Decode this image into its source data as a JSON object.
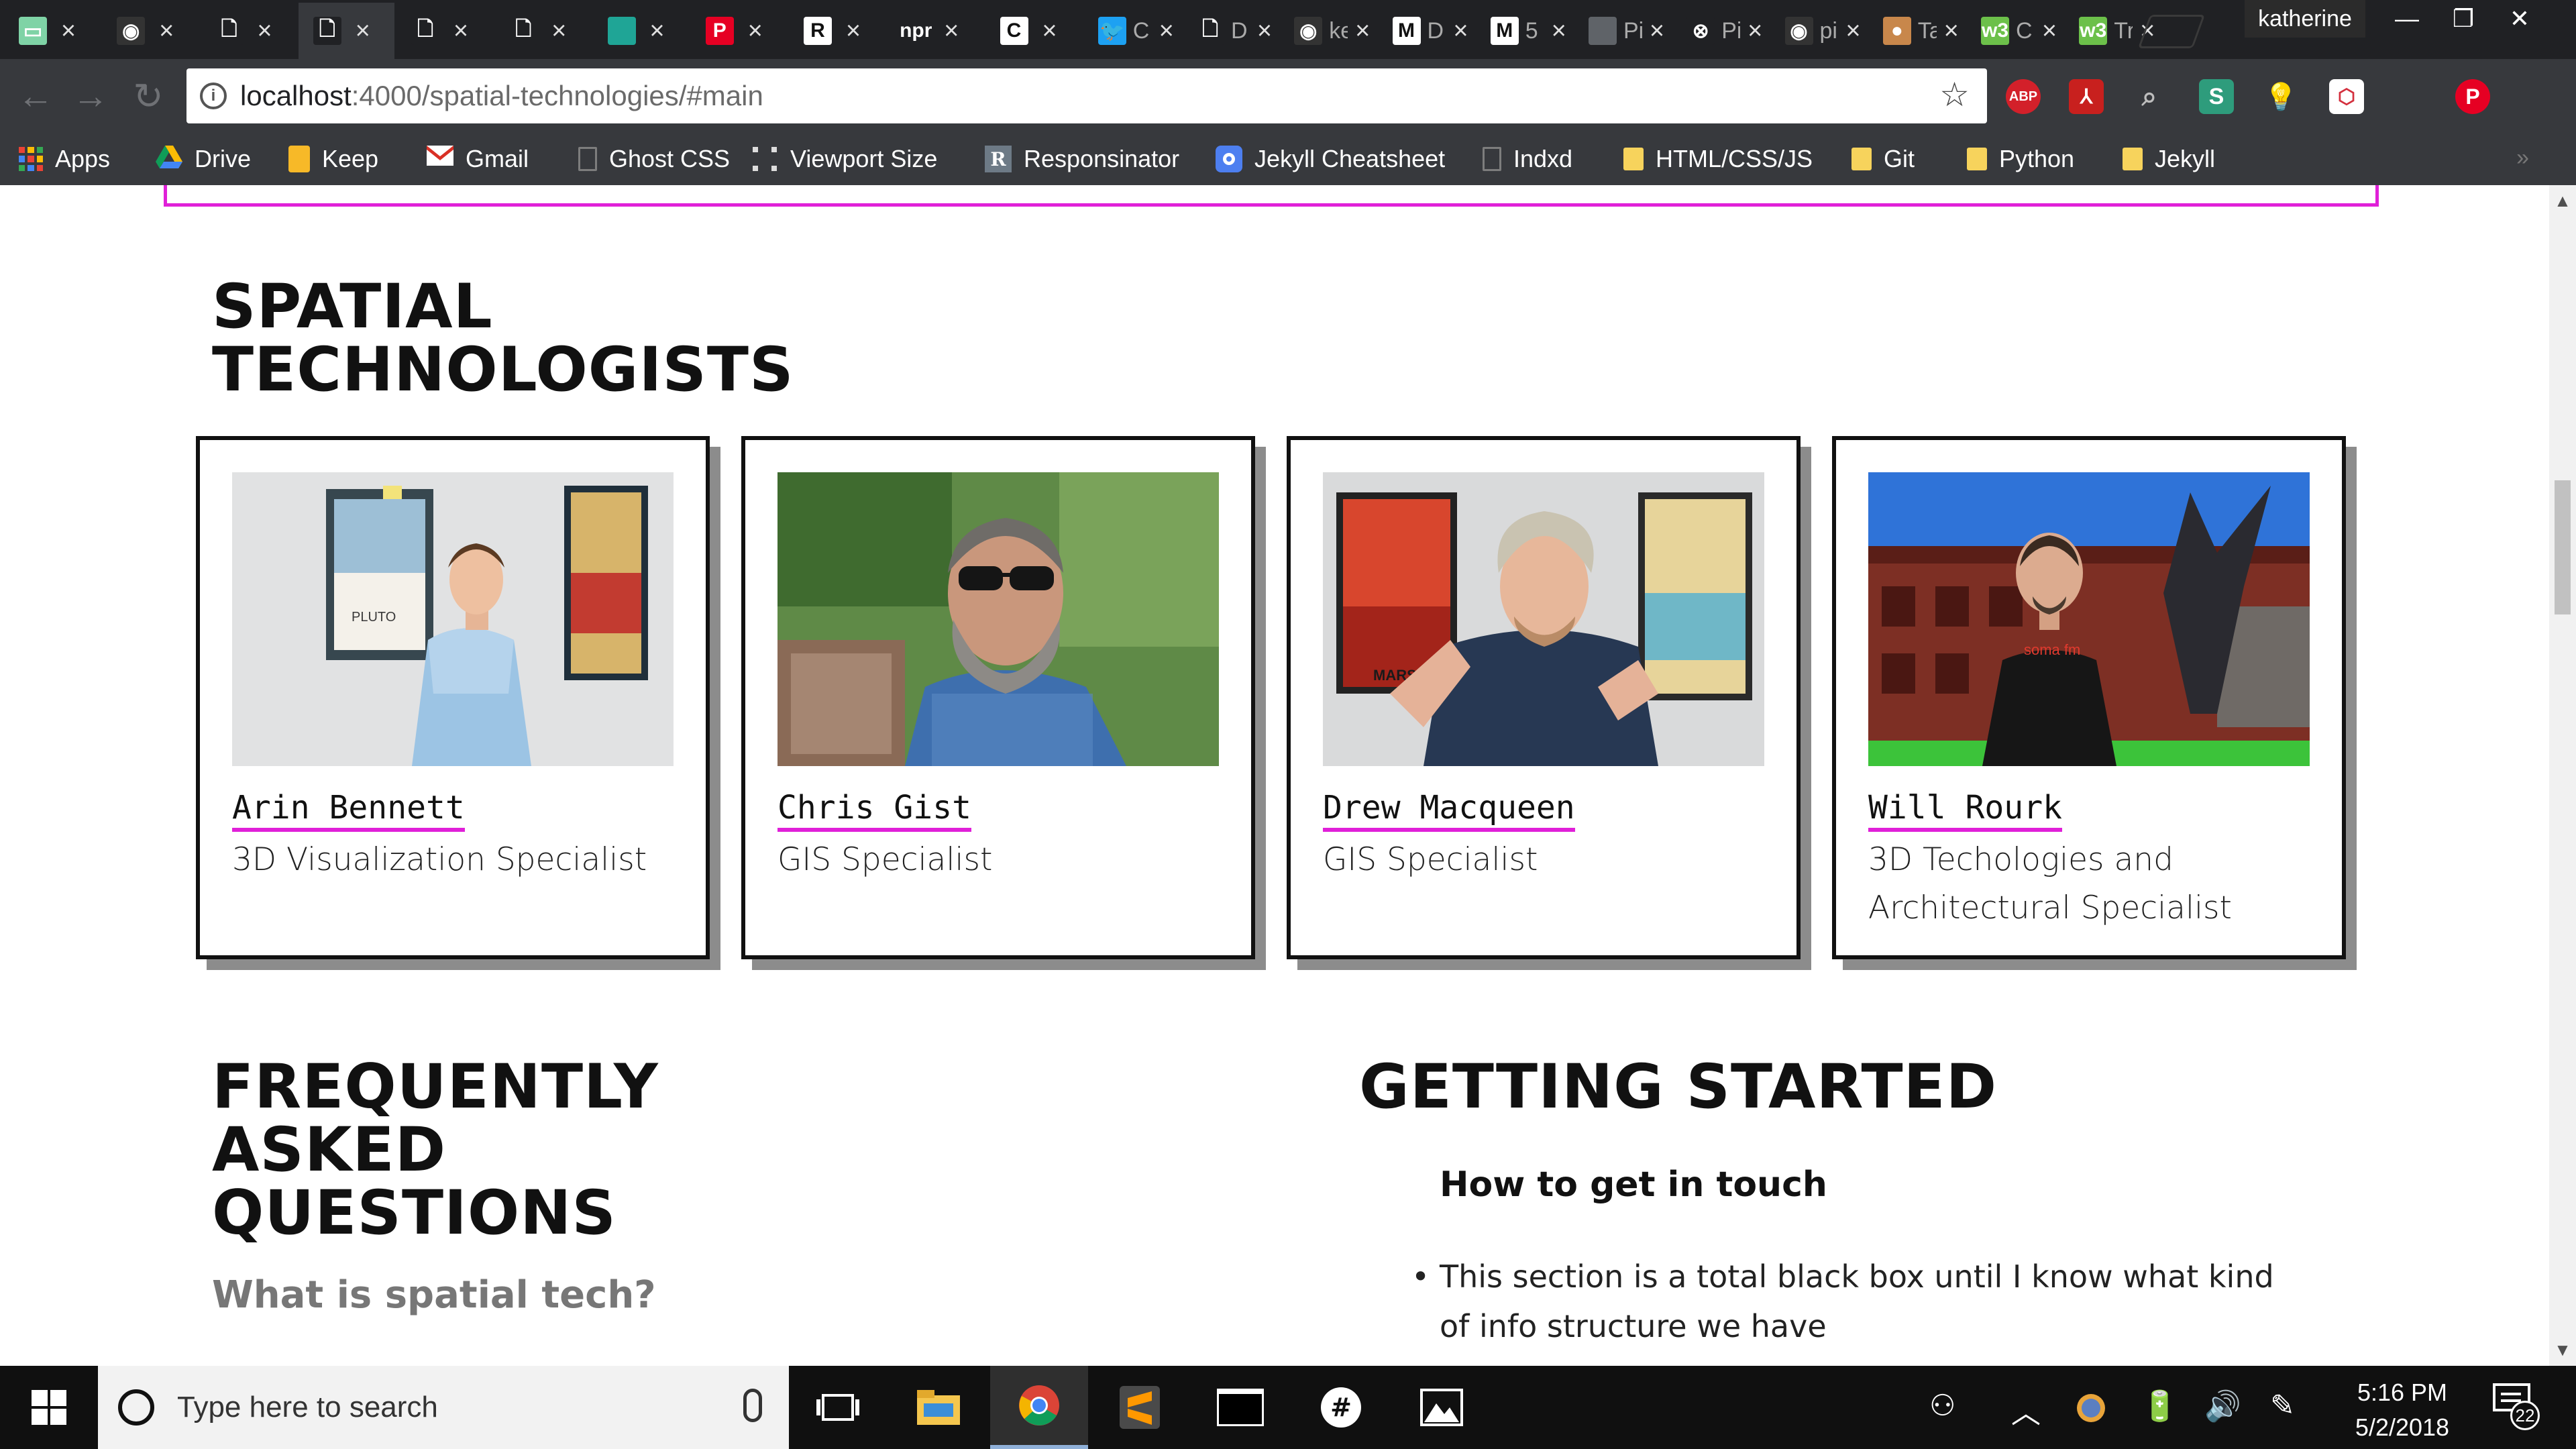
{
  "browser": {
    "tabs": [
      {
        "title": "",
        "favicon": "#7fd3a6",
        "glyph": "▭",
        "active": false
      },
      {
        "title": "",
        "favicon": "#333333",
        "glyph": "◉",
        "active": false
      },
      {
        "title": "",
        "favicon": "#202124",
        "glyph": "🗋",
        "active": false
      },
      {
        "title": "",
        "favicon": "#202124",
        "glyph": "🗋",
        "active": true
      },
      {
        "title": "",
        "favicon": "#202124",
        "glyph": "🗋",
        "active": false
      },
      {
        "title": "",
        "favicon": "#202124",
        "glyph": "🗋",
        "active": false
      },
      {
        "title": "",
        "favicon": "#1fa596",
        "glyph": "",
        "active": false
      },
      {
        "title": "",
        "favicon": "#e60023",
        "glyph": "P",
        "active": false
      },
      {
        "title": "",
        "favicon": "#ffffff",
        "glyph": "R",
        "active": false
      },
      {
        "title": "",
        "favicon": "#202124",
        "glyph": "npr",
        "active": false
      },
      {
        "title": "",
        "favicon": "#ffffff",
        "glyph": "C",
        "active": false
      },
      {
        "title": "C",
        "favicon": "#1da1f2",
        "glyph": "🐦",
        "active": false
      },
      {
        "title": "D",
        "favicon": "#202124",
        "glyph": "🗋",
        "active": false
      },
      {
        "title": "ke",
        "favicon": "#333333",
        "glyph": "◉",
        "active": false
      },
      {
        "title": "D",
        "favicon": "#ffffff",
        "glyph": "M",
        "active": false
      },
      {
        "title": "5",
        "favicon": "#ffffff",
        "glyph": "M",
        "active": false
      },
      {
        "title": "Pi",
        "favicon": "#5f6368",
        "glyph": "",
        "active": false
      },
      {
        "title": "Pi",
        "favicon": "#202124",
        "glyph": "⊗",
        "active": false
      },
      {
        "title": "pi",
        "favicon": "#333333",
        "glyph": "◉",
        "active": false
      },
      {
        "title": "Ta",
        "favicon": "#c8874b",
        "glyph": "●",
        "active": false
      },
      {
        "title": "C",
        "favicon": "#6cc04a",
        "glyph": "w3",
        "active": false
      },
      {
        "title": "Tr",
        "favicon": "#6cc04a",
        "glyph": "w3",
        "active": false
      }
    ],
    "profile_name": "katherine",
    "url_host": "localhost",
    "url_path": ":4000/spatial-technologies/#main",
    "bookmarks": [
      {
        "label": "Apps",
        "icon": "apps-grid-icon"
      },
      {
        "label": "Drive",
        "icon": "google-drive-icon"
      },
      {
        "label": "Keep",
        "icon": "google-keep-icon"
      },
      {
        "label": "Gmail",
        "icon": "gmail-icon"
      },
      {
        "label": "Ghost CSS",
        "icon": "page-icon"
      },
      {
        "label": "Viewport Size",
        "icon": "viewport-icon"
      },
      {
        "label": "Responsinator",
        "icon": "responsinator-icon"
      },
      {
        "label": "Jekyll Cheatsheet",
        "icon": "jekyll-icon"
      },
      {
        "label": "Indxd",
        "icon": "page-icon"
      },
      {
        "label": "HTML/CSS/JS",
        "icon": "folder-icon"
      },
      {
        "label": "Git",
        "icon": "folder-icon"
      },
      {
        "label": "Python",
        "icon": "folder-icon"
      },
      {
        "label": "Jekyll",
        "icon": "folder-icon"
      }
    ]
  },
  "page": {
    "technologists_title": "SPATIAL TECHNOLOGISTS",
    "technologists_title_lines": [
      "SPATIAL",
      "TECHNOLOGISTS"
    ],
    "people": [
      {
        "name": "Arin Bennett",
        "role": "3D Visualization Specialist"
      },
      {
        "name": "Chris Gist",
        "role": "GIS Specialist"
      },
      {
        "name": "Drew Macqueen",
        "role": "GIS Specialist"
      },
      {
        "name": "Will Rourk",
        "role": "3D Techologies and Architectural Specialist"
      }
    ],
    "faq_title_lines": [
      "FREQUENTLY",
      "ASKED",
      "QUESTIONS"
    ],
    "faq_first_question": "What is spatial tech?",
    "getting_started_title": "GETTING STARTED",
    "getting_started_subtitle": "How to get in touch",
    "getting_started_bullet": "This section is a total black box until I know what kind of info structure we have",
    "accent_color": "#e020d8"
  },
  "taskbar": {
    "search_placeholder": "Type here to search",
    "time": "5:16 PM",
    "date": "5/2/2018",
    "notification_count": "22"
  }
}
